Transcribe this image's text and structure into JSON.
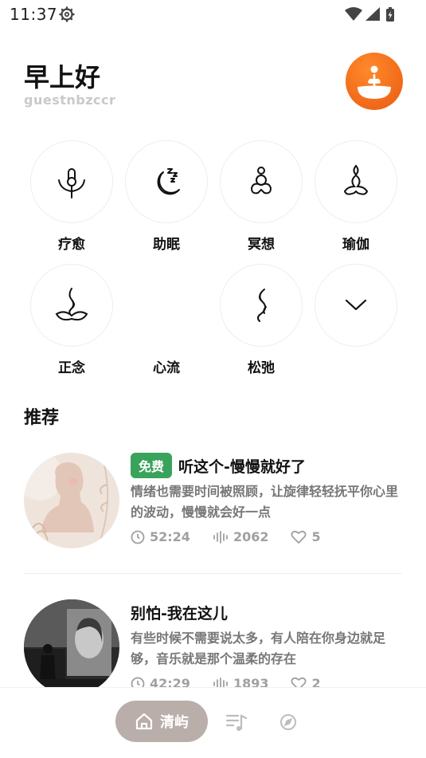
{
  "status": {
    "time": "11:37"
  },
  "header": {
    "greeting": "早上好",
    "username": "guestnbzccr"
  },
  "categories": [
    {
      "label": "疗愈",
      "icon": "lotus-seat-icon"
    },
    {
      "label": "助眠",
      "icon": "moon-zzz-icon"
    },
    {
      "label": "冥想",
      "icon": "meditation-figure-icon"
    },
    {
      "label": "瑜伽",
      "icon": "yoga-pose-icon"
    },
    {
      "label": "正念",
      "icon": "mindful-flame-icon"
    },
    {
      "label": "心流",
      "icon": ""
    },
    {
      "label": "松弛",
      "icon": "wave-smoke-icon"
    },
    {
      "label": "",
      "icon": "chevron-down-icon"
    }
  ],
  "recommend": {
    "title": "推荐",
    "items": [
      {
        "badge": "免费",
        "title": "听这个-慢慢就好了",
        "desc": "情绪也需要时间被照顾，让旋律轻轻抚平你心里的波动，慢慢就会好一点",
        "duration": "52:24",
        "plays": "2062",
        "likes": "5"
      },
      {
        "badge": "",
        "title": "别怕-我在这儿",
        "desc": "有些时候不需要说太多，有人陪在你身边就足够，音乐就是那个温柔的存在",
        "duration": "42:29",
        "plays": "1893",
        "likes": "2"
      }
    ]
  },
  "nav": {
    "home_label": "清屿"
  },
  "colors": {
    "accent": "#ea5a12",
    "badge": "#3aa35b",
    "nav_pill": "#b9aeaa"
  }
}
